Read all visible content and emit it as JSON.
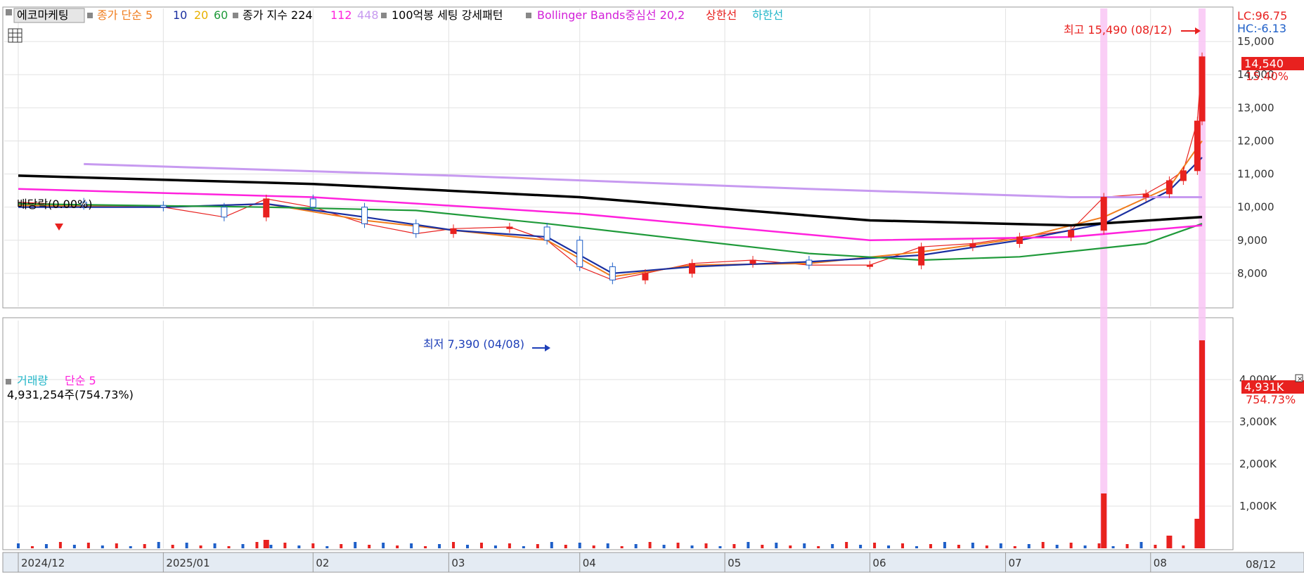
{
  "header": {
    "stock_name": "에코마케팅",
    "ma_label": "종가 단순 5",
    "ma_10": "10",
    "ma_20": "20",
    "ma_60": "60",
    "idx_label": "종가 지수 224",
    "idx_112": "112",
    "idx_448": "448",
    "pattern_label": "100억봉 세팅 강세패턴",
    "bb_label": "Bollinger Bands중심선 20,2",
    "upper_label": "상한선",
    "lower_label": "하한선"
  },
  "price_panel": {
    "lc_label": "LC:96.75",
    "hc_label": "HC:-6.13",
    "high_annotation": "최고 15,490 (08/12)",
    "low_annotation": "최저 7,390 (04/08)",
    "dividend_label": "배당락(0.00%)",
    "current_price": "14,540",
    "current_change": "15.40%",
    "y_ticks": [
      "15,000",
      "14,000",
      "13,000",
      "12,000",
      "11,000",
      "10,000",
      "9,000",
      "8,000"
    ]
  },
  "volume_panel": {
    "title": "거래량",
    "ma_label": "단순 5",
    "current_volume": "4,931,254주(754.73%)",
    "current_badge": "4,931K",
    "current_badge_pct": "754.73%",
    "y_ticks": [
      "4,000K",
      "3,000K",
      "2,000K",
      "1,000K"
    ]
  },
  "x_axis": {
    "labels": [
      "2024/12",
      "2025/01",
      "02",
      "03",
      "04",
      "05",
      "06",
      "07",
      "08"
    ],
    "right_label": "08/12"
  },
  "colors": {
    "up": "#e8211f",
    "down": "#1e5fc8",
    "ma5": "#f07c1c",
    "ma10": "#1a2fa0",
    "ma20": "#e8b000",
    "ma60": "#1f9a3a",
    "ma224": "#000000",
    "ma448": "#c79af0",
    "ma112": "#ff22dd",
    "bb_mid": "#ff22dd",
    "bb_upper": "#e8211f",
    "bb_lower": "#22b6c8",
    "highlight": "#f9c6f4"
  },
  "chart_data": [
    {
      "type": "line",
      "title": "에코마케팅",
      "y_range": [
        7000,
        16000
      ],
      "x_range": [
        "2024-12-02",
        "2025-08-12"
      ],
      "note_high": {
        "value": 15490,
        "date": "08/12"
      },
      "note_low": {
        "value": 7390,
        "date": "04/08"
      },
      "series": [
        {
          "name": "종가",
          "points": [
            [
              "2024-12-02",
              10150
            ],
            [
              "2024-12-16",
              10050
            ],
            [
              "2025-01-02",
              10000
            ],
            [
              "2025-01-15",
              9700
            ],
            [
              "2025-01-24",
              10250
            ],
            [
              "2025-02-03",
              10000
            ],
            [
              "2025-02-14",
              9500
            ],
            [
              "2025-02-25",
              9200
            ],
            [
              "2025-03-05",
              9350
            ],
            [
              "2025-03-17",
              9400
            ],
            [
              "2025-03-25",
              9000
            ],
            [
              "2025-04-01",
              8200
            ],
            [
              "2025-04-08",
              7800
            ],
            [
              "2025-04-15",
              8000
            ],
            [
              "2025-04-25",
              8300
            ],
            [
              "2025-05-08",
              8400
            ],
            [
              "2025-05-20",
              8250
            ],
            [
              "2025-06-02",
              8250
            ],
            [
              "2025-06-13",
              8800
            ],
            [
              "2025-06-24",
              8900
            ],
            [
              "2025-07-04",
              9100
            ],
            [
              "2025-07-15",
              9300
            ],
            [
              "2025-07-22",
              10300
            ],
            [
              "2025-07-31",
              10400
            ],
            [
              "2025-08-05",
              10800
            ],
            [
              "2025-08-08",
              11100
            ],
            [
              "2025-08-11",
              12600
            ],
            [
              "2025-08-12",
              14540
            ]
          ]
        },
        {
          "name": "5",
          "points": [
            [
              "2024-12-02",
              10050
            ],
            [
              "2025-01-02",
              10000
            ],
            [
              "2025-01-24",
              10100
            ],
            [
              "2025-02-14",
              9600
            ],
            [
              "2025-03-05",
              9300
            ],
            [
              "2025-03-25",
              9000
            ],
            [
              "2025-04-08",
              7900
            ],
            [
              "2025-04-25",
              8250
            ],
            [
              "2025-05-20",
              8300
            ],
            [
              "2025-06-13",
              8650
            ],
            [
              "2025-07-04",
              9050
            ],
            [
              "2025-07-22",
              9700
            ],
            [
              "2025-08-05",
              10600
            ],
            [
              "2025-08-12",
              12000
            ]
          ]
        },
        {
          "name": "10",
          "points": [
            [
              "2024-12-02",
              10000
            ],
            [
              "2025-01-02",
              10000
            ],
            [
              "2025-01-24",
              10100
            ],
            [
              "2025-02-14",
              9700
            ],
            [
              "2025-03-05",
              9300
            ],
            [
              "2025-03-25",
              9100
            ],
            [
              "2025-04-08",
              8000
            ],
            [
              "2025-04-25",
              8200
            ],
            [
              "2025-05-20",
              8350
            ],
            [
              "2025-06-13",
              8550
            ],
            [
              "2025-07-04",
              9000
            ],
            [
              "2025-07-22",
              9500
            ],
            [
              "2025-08-05",
              10500
            ],
            [
              "2025-08-12",
              11500
            ]
          ]
        },
        {
          "name": "60",
          "points": [
            [
              "2024-12-02",
              10100
            ],
            [
              "2025-01-24",
              10000
            ],
            [
              "2025-02-25",
              9900
            ],
            [
              "2025-03-25",
              9500
            ],
            [
              "2025-04-25",
              9000
            ],
            [
              "2025-05-20",
              8600
            ],
            [
              "2025-06-13",
              8400
            ],
            [
              "2025-07-04",
              8500
            ],
            [
              "2025-07-31",
              8900
            ],
            [
              "2025-08-12",
              9500
            ]
          ]
        },
        {
          "name": "224",
          "points": [
            [
              "2024-12-02",
              10950
            ],
            [
              "2025-02-03",
              10700
            ],
            [
              "2025-04-01",
              10300
            ],
            [
              "2025-06-02",
              9600
            ],
            [
              "2025-07-15",
              9450
            ],
            [
              "2025-08-12",
              9700
            ]
          ]
        },
        {
          "name": "112",
          "points": [
            [
              "2024-12-02",
              10550
            ],
            [
              "2025-02-03",
              10300
            ],
            [
              "2025-04-01",
              9800
            ],
            [
              "2025-06-02",
              9000
            ],
            [
              "2025-07-15",
              9100
            ],
            [
              "2025-08-12",
              9450
            ]
          ]
        },
        {
          "name": "448",
          "points": [
            [
              "2024-12-16",
              11300
            ],
            [
              "2025-03-05",
              10950
            ],
            [
              "2025-05-20",
              10550
            ],
            [
              "2025-07-15",
              10300
            ],
            [
              "2025-08-12",
              10300
            ]
          ]
        }
      ]
    },
    {
      "type": "bar",
      "title": "거래량",
      "y_range": [
        0,
        5000000
      ],
      "series": [
        {
          "name": "거래량",
          "points": [
            [
              "2025-01-24",
              200000
            ],
            [
              "2025-07-22",
              1300000
            ],
            [
              "2025-08-05",
              300000
            ],
            [
              "2025-08-11",
              700000
            ],
            [
              "2025-08-12",
              4931254
            ]
          ]
        }
      ]
    }
  ]
}
